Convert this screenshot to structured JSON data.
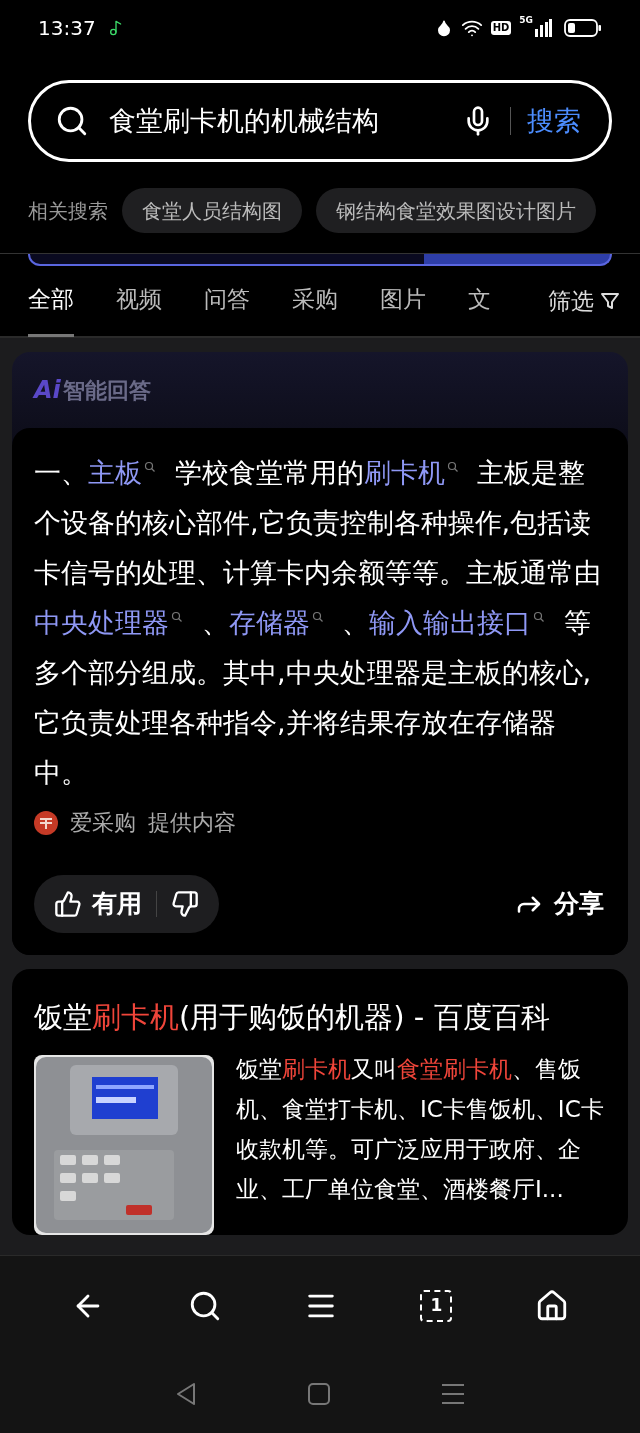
{
  "status_bar": {
    "time": "13:37",
    "hd": "HD",
    "network": "5G"
  },
  "search": {
    "value": "食堂刷卡机的机械结构",
    "button": "搜索"
  },
  "related": {
    "label": "相关搜索",
    "items": [
      "食堂人员结构图",
      "钢结构食堂效果图设计图片"
    ]
  },
  "tabs": [
    {
      "label": "全部",
      "selected": true
    },
    {
      "label": "视频",
      "selected": false
    },
    {
      "label": "问答",
      "selected": false
    },
    {
      "label": "采购",
      "selected": false
    },
    {
      "label": "图片",
      "selected": false
    },
    {
      "label": "文",
      "selected": false
    }
  ],
  "filter": {
    "label": "筛选"
  },
  "ai_answer": {
    "badge": "Ai",
    "title": "智能回答",
    "segments": [
      {
        "kind": "text",
        "text": "一、"
      },
      {
        "kind": "link",
        "text": "主板"
      },
      {
        "kind": "text",
        "text": " 学校食堂常用的"
      },
      {
        "kind": "link",
        "text": "刷卡机"
      },
      {
        "kind": "text",
        "text": " 主板是整个设备的核心部件,它负责控制各种操作,包括读卡信号的处理、计算卡内余额等等。主板通常由"
      },
      {
        "kind": "link",
        "text": "中央处理器"
      },
      {
        "kind": "text",
        "text": " 、"
      },
      {
        "kind": "link",
        "text": "存储器"
      },
      {
        "kind": "text",
        "text": " 、"
      },
      {
        "kind": "link",
        "text": "输入输出接口"
      },
      {
        "kind": "text",
        "text": " 等多个部分组成。其中,中央处理器是主板的核心,它负责处理各种指令,并将结果存放在存储器中。"
      }
    ],
    "source": {
      "name": "爱采购",
      "suffix": "提供内容"
    },
    "useful": "有用",
    "share": "分享"
  },
  "result": {
    "title": [
      {
        "kind": "text",
        "text": "饭堂"
      },
      {
        "kind": "hit",
        "text": "刷卡机"
      },
      {
        "kind": "text",
        "text": "(用于购饭的机器) - 百度百科"
      }
    ],
    "snippet": [
      {
        "kind": "text",
        "text": "饭堂"
      },
      {
        "kind": "hit",
        "text": "刷卡机"
      },
      {
        "kind": "text",
        "text": "又叫"
      },
      {
        "kind": "hit",
        "text": "食堂刷卡机"
      },
      {
        "kind": "text",
        "text": "、售饭机、食堂打卡机、IC卡售饭机、IC卡收款机等。可广泛应用于政府、企业、工厂单位食堂、酒楼餐厅I..."
      }
    ]
  },
  "bottom_nav": {
    "tab_count": "1"
  }
}
